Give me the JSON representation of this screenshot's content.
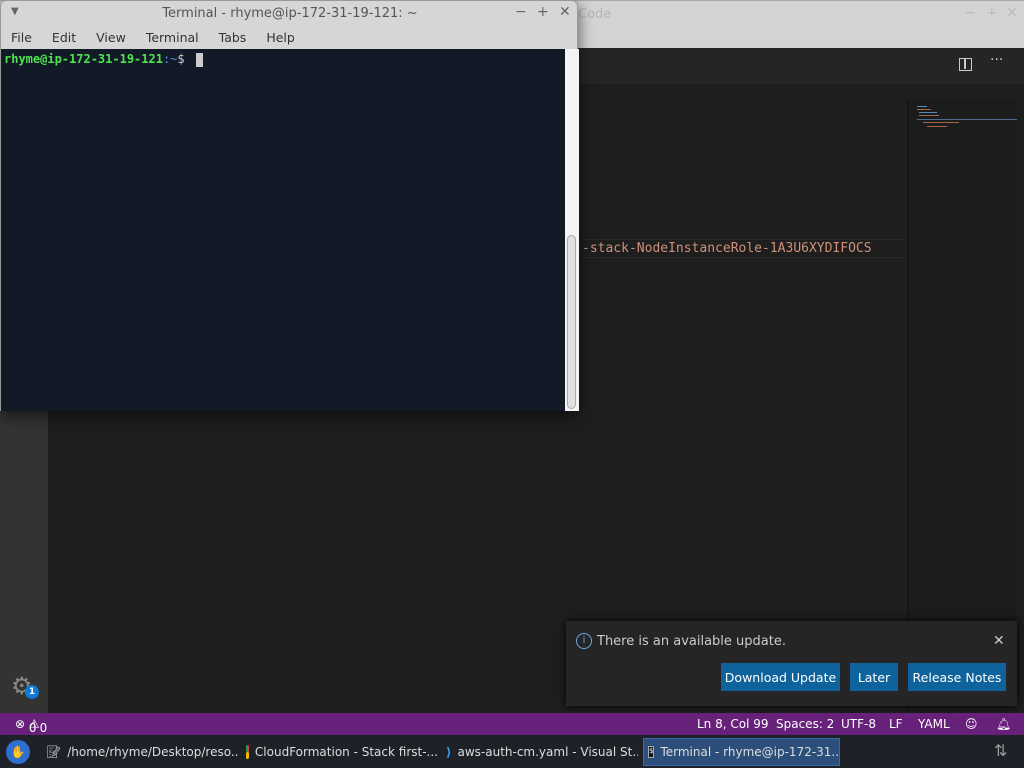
{
  "vscode": {
    "title_fragment": "Code",
    "code_line": "-stack-NodeInstanceRole-1A3U6XYDIFOCS",
    "settings_badge": "1"
  },
  "terminal": {
    "title": "Terminal - rhyme@ip-172-31-19-121: ~",
    "menu": [
      "File",
      "Edit",
      "View",
      "Terminal",
      "Tabs",
      "Help"
    ],
    "prompt_user": "rhyme@ip-172-31-19-121",
    "prompt_path": ":~",
    "prompt_symbol": "$"
  },
  "notification": {
    "message": "There is an available update.",
    "buttons": [
      "Download Update",
      "Later",
      "Release Notes"
    ]
  },
  "status": {
    "errors": "0",
    "warnings": "0",
    "position": "Ln 8, Col 99",
    "spaces": "Spaces: 2",
    "encoding": "UTF-8",
    "eol": "LF",
    "language": "YAML"
  },
  "taskbar": {
    "items": [
      "/home/rhyme/Desktop/reso...",
      "CloudFormation - Stack first-...",
      "aws-auth-cm.yaml - Visual St...",
      "Terminal - rhyme@ip-172-31..."
    ]
  }
}
